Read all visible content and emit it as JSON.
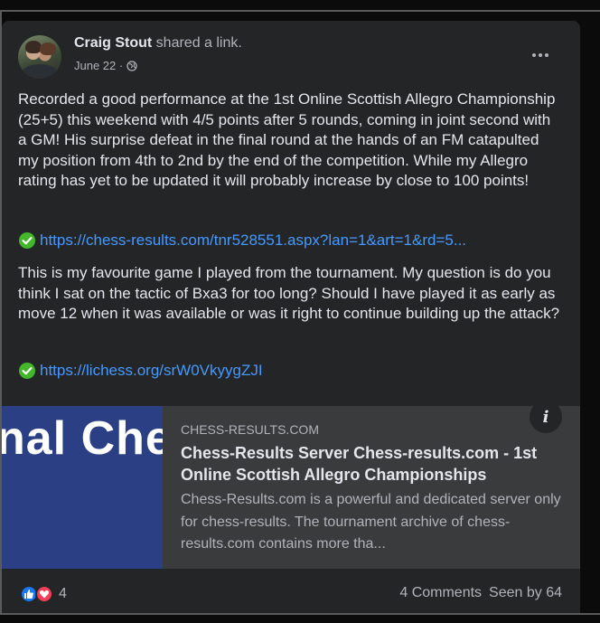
{
  "post": {
    "author": "Craig Stout",
    "action": " shared a link.",
    "date": "June 22 ·",
    "audience_icon": "globe-icon",
    "paragraph1": "Recorded a good performance at the 1st Online Scottish Allegro Championship (25+5) this weekend with 4/5 points after 5 rounds, coming in joint second with a GM! His surprise defeat in the final round at the hands of an FM catapulted my position from 4th to 2nd by the end of the competition. While my Allegro rating has yet to be updated it will probably increase by close to 100 points!",
    "link1": "https://chess-results.com/tnr528551.aspx?lan=1&art=1&rd=5...",
    "paragraph2": "This is my favourite game I played from the tournament. My question is do you think I sat on the tactic of Bxa3 for too long? Should I have played it as early as move 12 when it was available or was it right to continue building up the attack?",
    "link2": "https://lichess.org/srW0VkyygZJI"
  },
  "preview": {
    "image_text": "nal Che",
    "domain": "CHESS-RESULTS.COM",
    "title": "Chess-Results Server Chess-results.com - 1st Online Scottish Allegro Championships",
    "description": "Chess-Results.com is a powerful and dedicated server only for chess-results. The tournament archive of chess-results.com contains more tha...",
    "info_label": "i"
  },
  "footer": {
    "reaction_count": "4",
    "comments": "4 Comments",
    "seen_by": "Seen by 64"
  },
  "colors": {
    "card_bg": "#242526",
    "link": "#4599ff",
    "check": "#42b72a",
    "preview_bg": "#3a3b3c",
    "preview_image_bg": "#2b3f84",
    "like": "#1877f2",
    "love": "#f33e58"
  }
}
